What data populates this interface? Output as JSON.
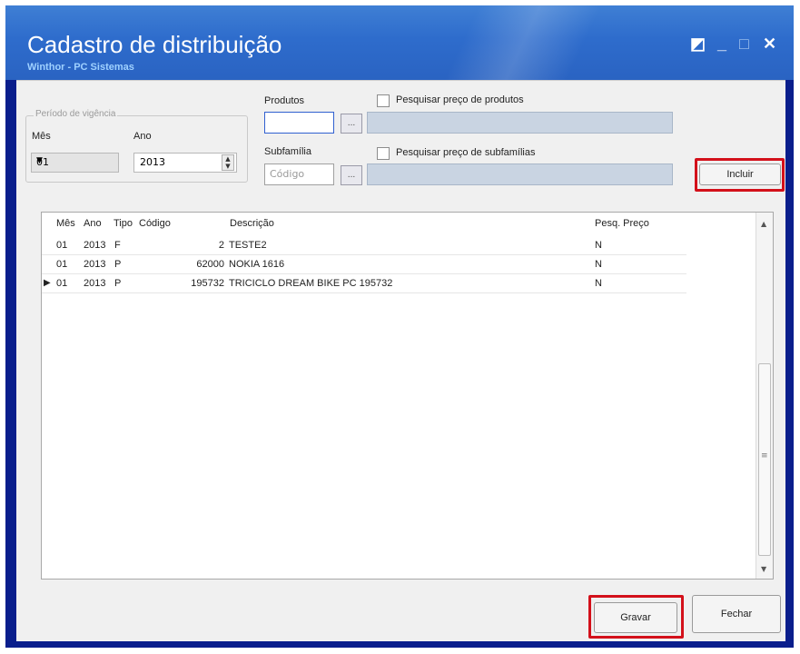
{
  "window": {
    "title": "Cadastro de distribuição",
    "subtitle": "Winthor - PC Sistemas"
  },
  "periodo": {
    "legend": "Período de vigência",
    "mes_label": "Mês",
    "mes_value": "01",
    "ano_label": "Ano",
    "ano_value": "2013"
  },
  "produtos": {
    "label": "Produtos",
    "value": "",
    "checkbox_label": "Pesquisar preço de produtos",
    "checked": false
  },
  "subfamilia": {
    "label": "Subfamília",
    "placeholder": "Código",
    "checkbox_label": "Pesquisar preço de subfamílias",
    "checked": false
  },
  "buttons": {
    "browse": "...",
    "incluir": "Incluir",
    "gravar": "Gravar",
    "fechar": "Fechar"
  },
  "table": {
    "columns": [
      "Mês",
      "Ano",
      "Tipo",
      "Código",
      "Descrição",
      "Pesq. Preço"
    ],
    "rows": [
      {
        "mes": "01",
        "ano": "2013",
        "tipo": "F",
        "codigo": "2",
        "descricao": "TESTE2",
        "pesq": "N"
      },
      {
        "mes": "01",
        "ano": "2013",
        "tipo": "P",
        "codigo": "62000",
        "descricao": "NOKIA 1616",
        "pesq": "N"
      },
      {
        "mes": "01",
        "ano": "2013",
        "tipo": "P",
        "codigo": "195732",
        "descricao": "TRICICLO DREAM BIKE  PC 195732",
        "pesq": "N"
      }
    ],
    "current_row_marker": "▶"
  },
  "colors": {
    "highlight": "#d3101a",
    "title_bar": "#2e6ccc"
  }
}
